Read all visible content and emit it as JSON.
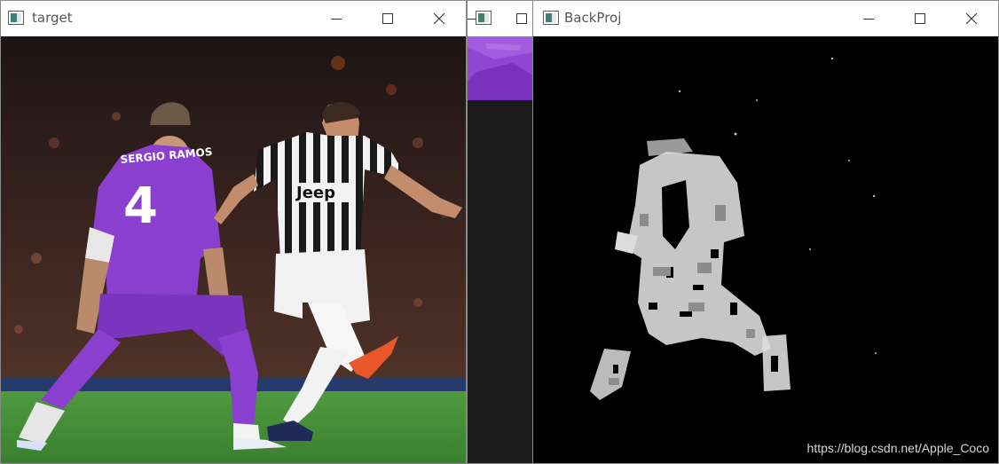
{
  "windows": {
    "target": {
      "title": "target"
    },
    "middle": {
      "title": ""
    },
    "backproj": {
      "title": "BackProj"
    }
  },
  "image_text": {
    "player_name": "SERGIO RAMOS",
    "player_number": "4",
    "sponsor": "Jeep"
  },
  "watermark": "https://blog.csdn.net/Apple_Coco",
  "icons": {
    "app": "window-app-icon",
    "minimize": "minimize-icon",
    "maximize": "maximize-icon",
    "close": "close-icon"
  },
  "colors": {
    "purple_kit": "#8a3fcf",
    "stripe_black": "#1a1a1a",
    "grass": "#3f8a36",
    "crowd": "#3a2420"
  }
}
